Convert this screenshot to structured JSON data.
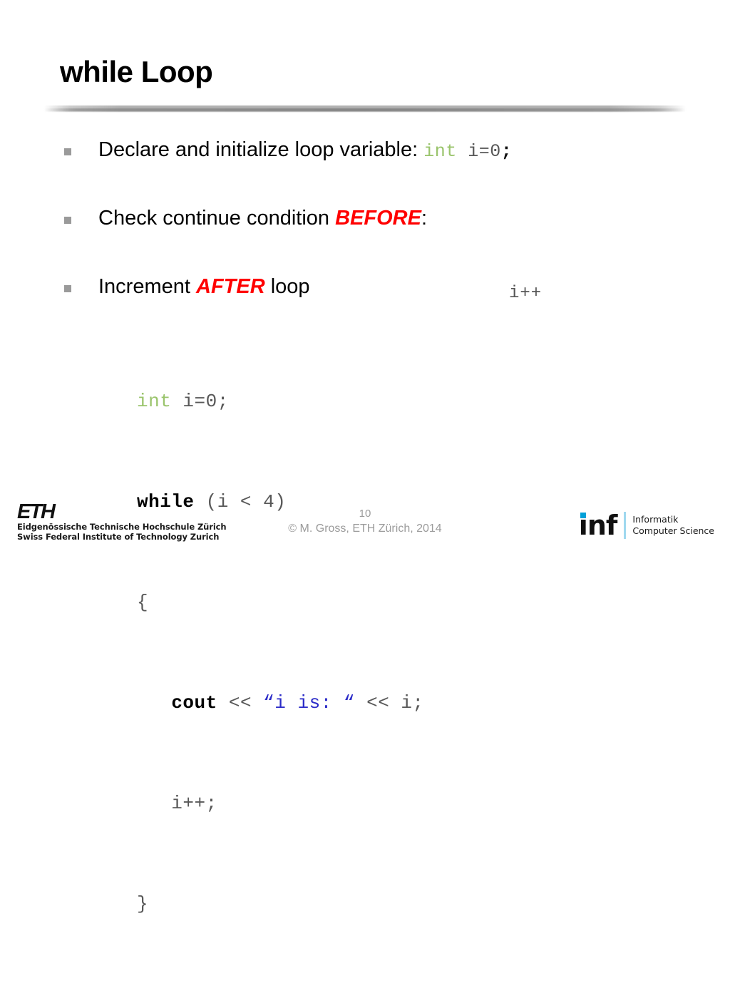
{
  "slide": {
    "title": "while Loop",
    "bullets": [
      {
        "text_before": "Declare and initialize loop variable: ",
        "code_keyword": "int",
        "code_rest": " i=0",
        "code_semicolon": ";"
      },
      {
        "text_before": "Check continue condition ",
        "emphasis": "BEFORE",
        "text_after": ":"
      },
      {
        "text_before": "Increment ",
        "emphasis": "AFTER",
        "text_after": " loop"
      }
    ],
    "side_note": "i++",
    "code": {
      "line1_keyword": "int",
      "line1_rest": " i=0;",
      "line2_keyword": "while",
      "line2_rest": " (i < 4)",
      "line3": "{",
      "line4_keyword": "cout",
      "line4_op1": " << ",
      "line4_string": "“i is: “",
      "line4_op2": " << i;",
      "line4_indent": "   ",
      "line5": "   i++;",
      "line6": "}"
    },
    "footer": {
      "slide_number": "10",
      "copyright": "© M. Gross, ETH Zürich, 2014"
    },
    "eth_logo": {
      "wordmark": "ETH",
      "line1": "Eidgenössische Technische Hochschule Zürich",
      "line2": "Swiss Federal Institute of Technology Zurich"
    },
    "inf_logo": {
      "wordmark": "inf",
      "line1": "Informatik",
      "line2": "Computer Science"
    },
    "colors": {
      "accent_red": "#ff0000",
      "code_green": "#9ac46c",
      "string_blue": "#2b2bc8",
      "bullet_gray": "#9a9a9a",
      "footer_gray": "#9b9b9b",
      "inf_cyan": "#00a0d8"
    }
  }
}
